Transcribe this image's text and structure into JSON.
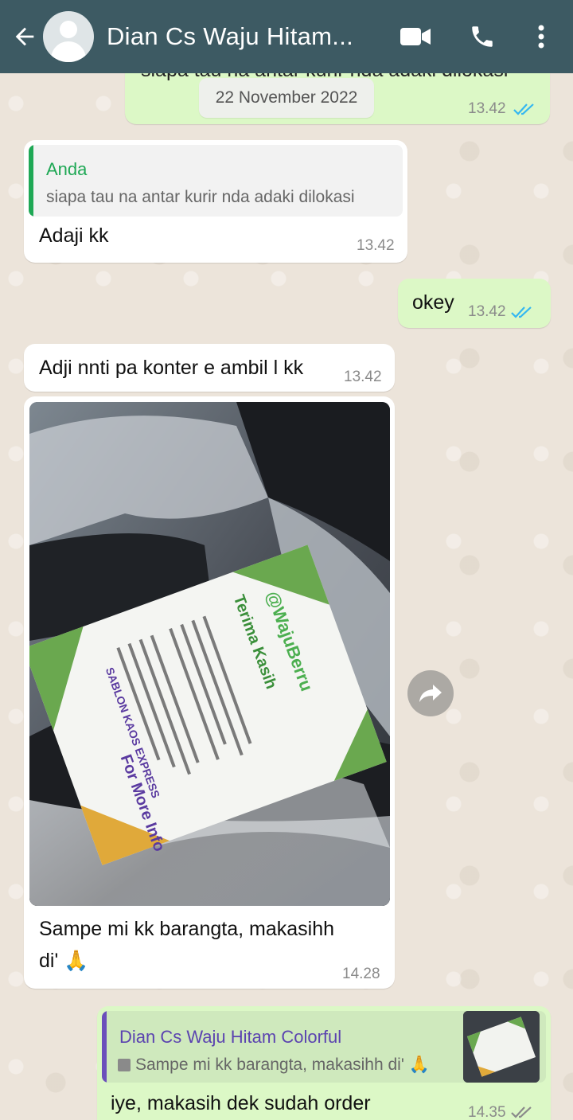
{
  "header": {
    "title": "Dian Cs Waju Hitam...",
    "icons": [
      "back-arrow-icon",
      "avatar",
      "video-call-icon",
      "phone-icon",
      "more-vert-icon"
    ]
  },
  "date_separator": "22 November 2022",
  "messages": [
    {
      "id": "m0",
      "direction": "out",
      "text_cut": "siapa tau na antar kurir nda adaki dilokasi",
      "time": "13.42",
      "status": "read"
    },
    {
      "id": "m1",
      "direction": "in",
      "quote": {
        "author": "Anda",
        "text": "siapa tau na antar kurir nda adaki dilokasi"
      },
      "text": "Adaji kk",
      "time": "13.42"
    },
    {
      "id": "m2",
      "direction": "out",
      "text": "okey",
      "time": "13.42",
      "status": "read"
    },
    {
      "id": "m3",
      "direction": "in",
      "text": "Adji nnti pa konter e ambil l kk",
      "time": "13.42"
    },
    {
      "id": "m4",
      "direction": "in",
      "type": "image",
      "image_card": {
        "handle": "@WajuBerru",
        "heading": "Terima Kasih",
        "footer": "For More Info",
        "brand": "SABLON KAOS EXPRESS"
      },
      "caption_line1": "Sampe mi kk barangta, makasihh",
      "caption_line2": "di' 🙏",
      "time": "14.28"
    },
    {
      "id": "m5",
      "direction": "out",
      "quote": {
        "author": "Dian Cs Waju Hitam Colorful",
        "text": "Sampe mi kk barangta, makasihh di' 🙏"
      },
      "text": "iye, makasih dek sudah order",
      "time": "14.35",
      "status": "sent"
    }
  ],
  "colors": {
    "header": "#3d5a63",
    "incoming": "#ffffff",
    "outgoing": "#dcf8c6",
    "read_ticks": "#34b7f1",
    "quote_you": "#1fa855",
    "quote_other": "#6b4fbb"
  }
}
